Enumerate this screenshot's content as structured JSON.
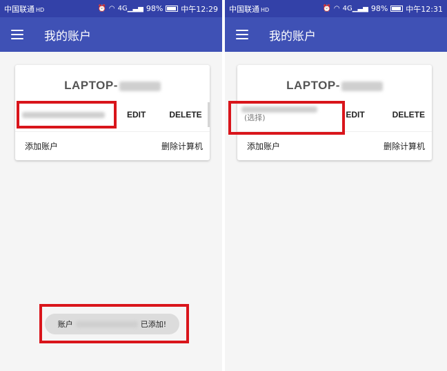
{
  "left": {
    "status": {
      "carrier": "中国联通",
      "carrier_icon": "HD",
      "network": "4G",
      "battery": "98%",
      "time": "中午12:29"
    },
    "appbar": {
      "title": "我的账户"
    },
    "card": {
      "machine_prefix": "LAPTOP-",
      "edit_label": "EDIT",
      "delete_label": "DELETE",
      "add_account": "添加账户",
      "remove_machine": "删除计算机"
    },
    "toast": {
      "prefix": "账户",
      "suffix": "已添加!"
    }
  },
  "right": {
    "status": {
      "carrier": "中国联通",
      "carrier_icon": "HD",
      "network": "4G",
      "battery": "98%",
      "time": "中午12:31"
    },
    "appbar": {
      "title": "我的账户"
    },
    "card": {
      "machine_prefix": "LAPTOP-",
      "selected_suffix": "(选择)",
      "edit_label": "EDIT",
      "delete_label": "DELETE",
      "add_account": "添加账户",
      "remove_machine": "删除计算机"
    }
  },
  "colors": {
    "appbar": "#3f51b5",
    "statusbar": "#3341a8",
    "highlight": "#d9151b"
  },
  "icons": [
    "menu-icon",
    "alarm-icon",
    "wifi-icon",
    "signal-icon",
    "battery-icon"
  ]
}
